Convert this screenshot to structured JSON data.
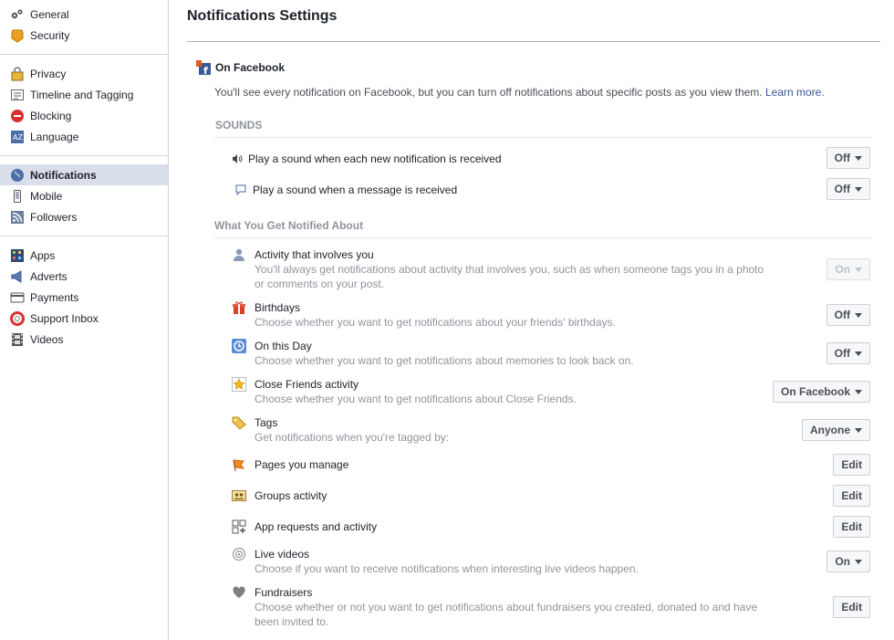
{
  "sidebar": {
    "groups": [
      [
        {
          "label": "General",
          "icon": "gears-icon"
        },
        {
          "label": "Security",
          "icon": "shield-badge-icon"
        }
      ],
      [
        {
          "label": "Privacy",
          "icon": "lock-icon"
        },
        {
          "label": "Timeline and Tagging",
          "icon": "timeline-icon"
        },
        {
          "label": "Blocking",
          "icon": "block-icon"
        },
        {
          "label": "Language",
          "icon": "language-icon"
        }
      ],
      [
        {
          "label": "Notifications",
          "icon": "globe-icon",
          "active": true
        },
        {
          "label": "Mobile",
          "icon": "phone-icon"
        },
        {
          "label": "Followers",
          "icon": "rss-icon"
        }
      ],
      [
        {
          "label": "Apps",
          "icon": "apps-grid-icon"
        },
        {
          "label": "Adverts",
          "icon": "megaphone-icon"
        },
        {
          "label": "Payments",
          "icon": "credit-card-icon"
        },
        {
          "label": "Support Inbox",
          "icon": "lifebuoy-icon"
        },
        {
          "label": "Videos",
          "icon": "film-icon"
        }
      ]
    ]
  },
  "page": {
    "title": "Notifications Settings"
  },
  "on_facebook": {
    "heading": "On Facebook",
    "intro": "You'll see every notification on Facebook, but you can turn off notifications about specific posts as you view them.",
    "learn_more": "Learn more."
  },
  "sounds": {
    "heading": "SOUNDS",
    "rows": [
      {
        "title": "Play a sound when each new notification is received",
        "value": "Off",
        "icon": "speaker-icon"
      },
      {
        "title": "Play a sound when a message is received",
        "value": "Off",
        "icon": "chat-bubble-icon"
      }
    ]
  },
  "notified": {
    "heading": "What You Get Notified About",
    "rows": [
      {
        "title": "Activity that involves you",
        "desc": "You'll always get notifications about activity that involves you, such as when someone tags you in a photo",
        "desc2": "or comments on your post.",
        "value": "On",
        "disabled": true,
        "icon": "person-icon"
      },
      {
        "title": "Birthdays",
        "desc": "Choose whether you want to get notifications about your friends' birthdays.",
        "value": "Off",
        "icon": "gift-icon"
      },
      {
        "title": "On this Day",
        "desc": "Choose whether you want to get notifications about memories to look back on.",
        "value": "Off",
        "icon": "clock-history-icon"
      },
      {
        "title": "Close Friends activity",
        "desc": "Choose whether you want to get notifications about Close Friends.",
        "value": "On Facebook",
        "icon": "star-icon"
      },
      {
        "title": "Tags",
        "desc": "Get notifications when you're tagged by:",
        "value": "Anyone",
        "icon": "tag-icon"
      },
      {
        "title": "Pages you manage",
        "value": "Edit",
        "button": true,
        "icon": "flag-icon"
      },
      {
        "title": "Groups activity",
        "value": "Edit",
        "button": true,
        "icon": "group-icon"
      },
      {
        "title": "App requests and activity",
        "value": "Edit",
        "button": true,
        "icon": "app-request-icon"
      },
      {
        "title": "Live videos",
        "desc": "Choose if you want to receive notifications when interesting live videos happen.",
        "value": "On",
        "icon": "live-icon"
      },
      {
        "title": "Fundraisers",
        "desc": "Choose whether or not you want to get notifications about fundraisers you created, donated to and have",
        "desc2": "been invited to.",
        "value": "Edit",
        "button": true,
        "icon": "heart-icon"
      }
    ]
  },
  "colors": {
    "link": "#365899",
    "active_bg": "#d8dfea",
    "muted_text": "#90949c"
  }
}
